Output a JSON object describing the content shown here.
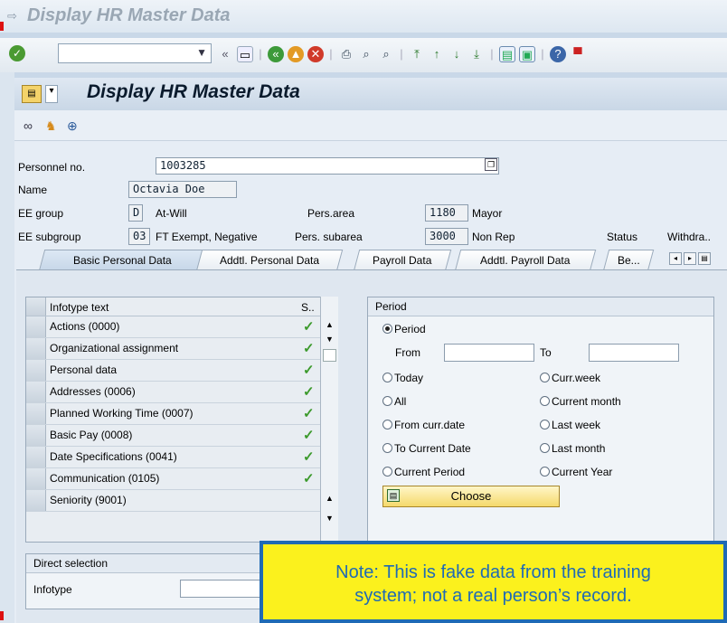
{
  "window": {
    "title": "Display HR Master Data",
    "title_icon": "exit-icon"
  },
  "toolbar": {
    "command_value": "",
    "icons": [
      "back-icon",
      "exit-icon",
      "cancel-icon",
      "print-icon",
      "find-icon",
      "find-next-icon",
      "first-page-icon",
      "prev-page-icon",
      "next-page-icon",
      "last-page-icon",
      "new-session-icon",
      "shortcut-icon",
      "help-icon",
      "customize-icon"
    ],
    "collapse": "«"
  },
  "screen": {
    "title": "Display HR Master Data",
    "tool_icons": [
      "glasses-icon",
      "person-icon",
      "org-icon"
    ]
  },
  "header": {
    "personnel_no_label": "Personnel no.",
    "personnel_no": "1003285",
    "name_label": "Name",
    "name": "Octavia Doe",
    "ee_group_label": "EE group",
    "ee_group_code": "D",
    "ee_group_text": "At-Will",
    "pers_area_label": "Pers.area",
    "pers_area_code": "1180",
    "pers_area_text": "Mayor",
    "ee_subgroup_label": "EE subgroup",
    "ee_subgroup_code": "03",
    "ee_subgroup_text": "FT Exempt,  Negative",
    "pers_subarea_label": "Pers. subarea",
    "pers_subarea_code": "3000",
    "pers_subarea_text": "Non Rep",
    "status_label": "Status",
    "status_value": "Withdra.."
  },
  "tabs": [
    {
      "label": "Basic Personal Data",
      "active": true
    },
    {
      "label": "Addtl. Personal Data",
      "active": false
    },
    {
      "label": "Payroll Data",
      "active": false
    },
    {
      "label": "Addtl. Payroll Data",
      "active": false
    },
    {
      "label": "Be...",
      "active": false
    }
  ],
  "infotypes": {
    "col_text": "Infotype text",
    "col_s": "S..",
    "rows": [
      {
        "text": "Actions (0000)",
        "checked": true
      },
      {
        "text": "Organizational assignment",
        "checked": true
      },
      {
        "text": "Personal data",
        "checked": true
      },
      {
        "text": "Addresses (0006)",
        "checked": true
      },
      {
        "text": "Planned Working Time (0007)",
        "checked": true
      },
      {
        "text": "Basic Pay (0008)",
        "checked": true
      },
      {
        "text": "Date Specifications (0041)",
        "checked": true
      },
      {
        "text": "Communication (0105)",
        "checked": true
      },
      {
        "text": "Seniority (9001)",
        "checked": false
      }
    ]
  },
  "period": {
    "title": "Period",
    "period_label": "Period",
    "from_label": "From",
    "from_value": "",
    "to_label": "To",
    "to_value": "",
    "today": "Today",
    "curr_week": "Curr.week",
    "all": "All",
    "current_month": "Current month",
    "from_curr_date": "From curr.date",
    "last_week": "Last week",
    "to_current_date": "To Current Date",
    "last_month": "Last month",
    "current_period": "Current Period",
    "current_year": "Current Year",
    "choose": "Choose"
  },
  "direct": {
    "title": "Direct selection",
    "infotype_label": "Infotype",
    "infotype_value": ""
  },
  "note": {
    "line1": "Note:  This is fake data from the training",
    "line2": "system; not a real person’s record."
  }
}
